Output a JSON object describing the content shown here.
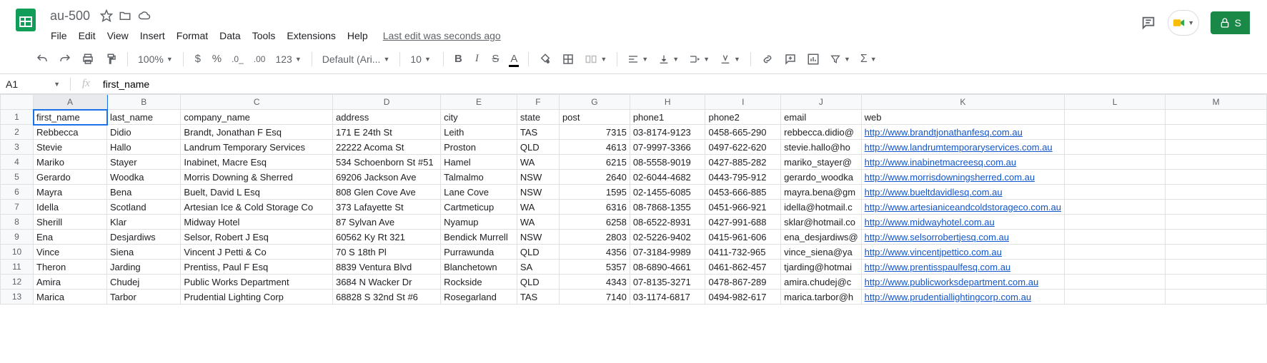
{
  "doc": {
    "title": "au-500",
    "last_edit": "Last edit was seconds ago"
  },
  "menus": [
    "File",
    "Edit",
    "View",
    "Insert",
    "Format",
    "Data",
    "Tools",
    "Extensions",
    "Help"
  ],
  "toolbar": {
    "zoom": "100%",
    "font": "Default (Ari...",
    "size": "10"
  },
  "share": "S",
  "namebox": {
    "ref": "A1",
    "formula": "first_name"
  },
  "cols": [
    "A",
    "B",
    "C",
    "D",
    "E",
    "F",
    "G",
    "H",
    "I",
    "J",
    "K",
    "L",
    "M"
  ],
  "headers": [
    "first_name",
    "last_name",
    "company_name",
    "address",
    "city",
    "state",
    "post",
    "phone1",
    "phone2",
    "email",
    "web",
    "",
    ""
  ],
  "rows": [
    [
      "Rebbecca",
      "Didio",
      "Brandt, Jonathan F Esq",
      "171 E 24th St",
      "Leith",
      "TAS",
      "7315",
      "03-8174-9123",
      "0458-665-290",
      "rebbecca.didio@",
      "http://www.brandtjonathanfesq.com.au",
      "",
      ""
    ],
    [
      "Stevie",
      "Hallo",
      "Landrum Temporary Services",
      "22222 Acoma St",
      "Proston",
      "QLD",
      "4613",
      "07-9997-3366",
      "0497-622-620",
      "stevie.hallo@ho",
      "http://www.landrumtemporaryservices.com.au",
      "",
      ""
    ],
    [
      "Mariko",
      "Stayer",
      "Inabinet, Macre Esq",
      "534 Schoenborn St #51",
      "Hamel",
      "WA",
      "6215",
      "08-5558-9019",
      "0427-885-282",
      "mariko_stayer@",
      "http://www.inabinetmacreesq.com.au",
      "",
      ""
    ],
    [
      "Gerardo",
      "Woodka",
      "Morris Downing & Sherred",
      "69206 Jackson Ave",
      "Talmalmo",
      "NSW",
      "2640",
      "02-6044-4682",
      "0443-795-912",
      "gerardo_woodka",
      "http://www.morrisdowningsherred.com.au",
      "",
      ""
    ],
    [
      "Mayra",
      "Bena",
      "Buelt, David L Esq",
      "808 Glen Cove Ave",
      "Lane Cove",
      "NSW",
      "1595",
      "02-1455-6085",
      "0453-666-885",
      "mayra.bena@gm",
      "http://www.bueltdavidlesq.com.au",
      "",
      ""
    ],
    [
      "Idella",
      "Scotland",
      "Artesian Ice & Cold Storage Co",
      "373 Lafayette St",
      "Cartmeticup",
      "WA",
      "6316",
      "08-7868-1355",
      "0451-966-921",
      "idella@hotmail.c",
      "http://www.artesianiceandcoldstorageco.com.au",
      "",
      ""
    ],
    [
      "Sherill",
      "Klar",
      "Midway Hotel",
      "87 Sylvan Ave",
      "Nyamup",
      "WA",
      "6258",
      "08-6522-8931",
      "0427-991-688",
      "sklar@hotmail.co",
      "http://www.midwayhotel.com.au",
      "",
      ""
    ],
    [
      "Ena",
      "Desjardiws",
      "Selsor, Robert J Esq",
      "60562 Ky Rt 321",
      "Bendick Murrell",
      "NSW",
      "2803",
      "02-5226-9402",
      "0415-961-606",
      "ena_desjardiws@",
      "http://www.selsorrobertjesq.com.au",
      "",
      ""
    ],
    [
      "Vince",
      "Siena",
      "Vincent J Petti & Co",
      "70 S 18th Pl",
      "Purrawunda",
      "QLD",
      "4356",
      "07-3184-9989",
      "0411-732-965",
      "vince_siena@ya",
      "http://www.vincentjpettico.com.au",
      "",
      ""
    ],
    [
      "Theron",
      "Jarding",
      "Prentiss, Paul F Esq",
      "8839 Ventura Blvd",
      "Blanchetown",
      "SA",
      "5357",
      "08-6890-4661",
      "0461-862-457",
      "tjarding@hotmai",
      "http://www.prentisspaulfesq.com.au",
      "",
      ""
    ],
    [
      "Amira",
      "Chudej",
      "Public Works Department",
      "3684 N Wacker Dr",
      "Rockside",
      "QLD",
      "4343",
      "07-8135-3271",
      "0478-867-289",
      "amira.chudej@c",
      "http://www.publicworksdepartment.com.au",
      "",
      ""
    ],
    [
      "Marica",
      "Tarbor",
      "Prudential Lighting Corp",
      "68828 S 32nd St #6",
      "Rosegarland",
      "TAS",
      "7140",
      "03-1174-6817",
      "0494-982-617",
      "marica.tarbor@h",
      "http://www.prudentiallightingcorp.com.au",
      "",
      ""
    ]
  ]
}
